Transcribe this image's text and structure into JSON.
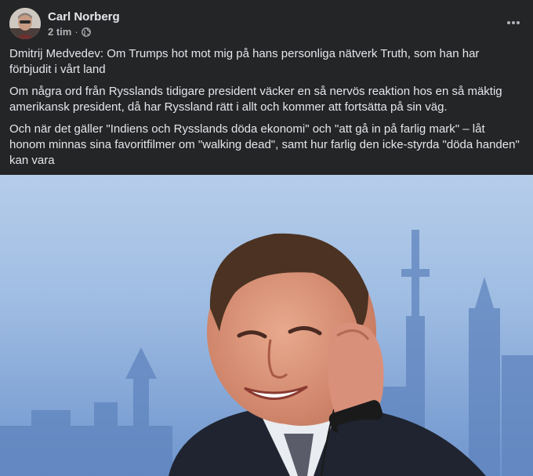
{
  "post": {
    "author": "Carl Norberg",
    "time": "2 tim",
    "separator": "·",
    "privacy_icon": "globe-icon",
    "menu_icon": "more-horizontal-icon",
    "paragraphs": [
      "Dmitrij Medvedev: Om Trumps hot mot mig på hans personliga nätverk Truth, som han har förbjudit i vårt land",
      "Om några ord från Rysslands tidigare president väcker en så nervös reaktion hos en så mäktig amerikansk president, då har Ryssland rätt i allt och kommer att fortsätta på sin väg.",
      "Och när det gäller \"Indiens och Rysslands döda ekonomi\" och \"att gå in på farlig mark\" – låt honom minnas sina favoritfilmer om \"walking dead\", samt hur farlig den icke-styrda \"döda handen\" kan vara"
    ]
  },
  "colors": {
    "background": "#242526",
    "primary_text": "#e4e6eb",
    "secondary_text": "#b0b3b8"
  }
}
